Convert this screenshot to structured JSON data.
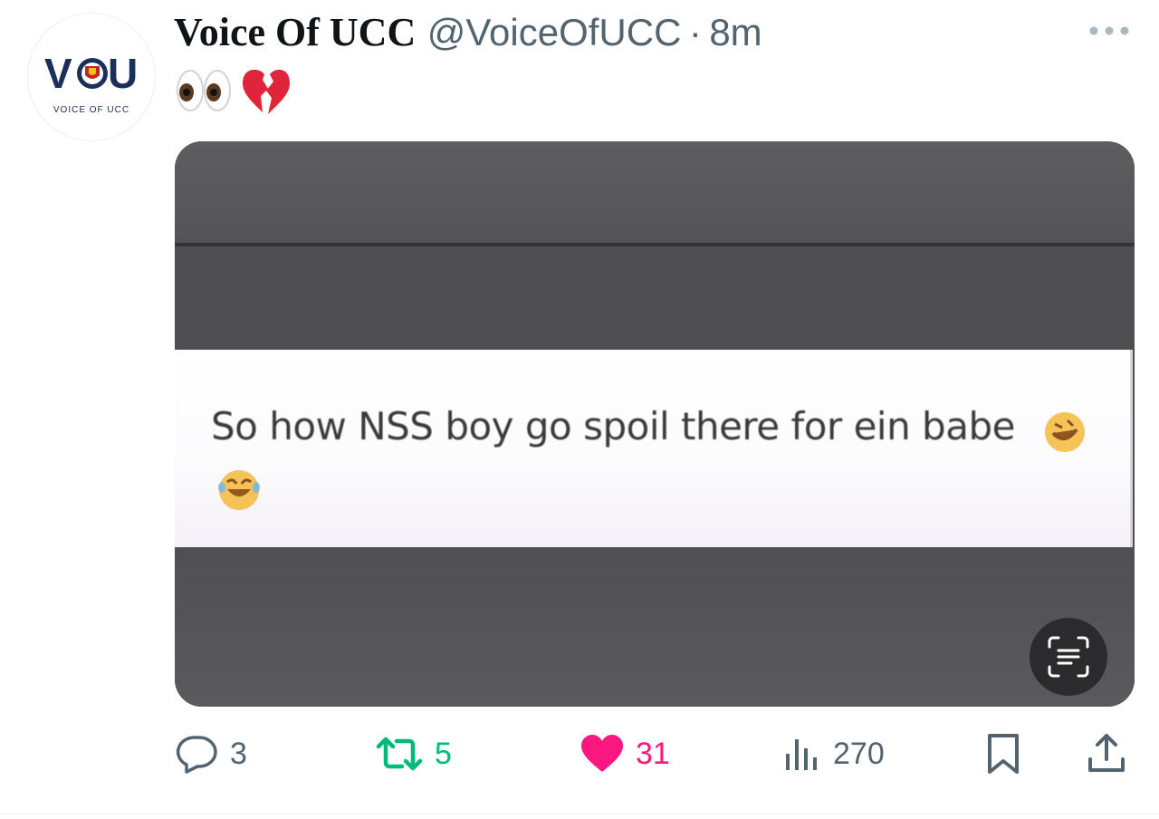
{
  "tweet": {
    "display_name": "Voice Of UCC",
    "handle": "@VoiceOfUCC",
    "separator": "·",
    "timestamp": "8m",
    "emojis": [
      "eyes-emoji",
      "broken-heart-emoji"
    ]
  },
  "avatar": {
    "logo_text": "VOU",
    "caption": "VOICE OF UCC",
    "brand_color": "#1b2f5c"
  },
  "media": {
    "caption_text": "So how NSS boy go spoil there for ein babe",
    "caption_emojis": [
      "rolling-laughing-emoji",
      "crying-laughing-emoji"
    ],
    "alt_text_icon": "text-recognition-icon"
  },
  "actions": {
    "reply_count": "3",
    "retweet_count": "5",
    "like_count": "31",
    "view_count": "270",
    "colors": {
      "neutral": "#536471",
      "retweet": "#00ba7c",
      "like": "#f91880"
    }
  }
}
